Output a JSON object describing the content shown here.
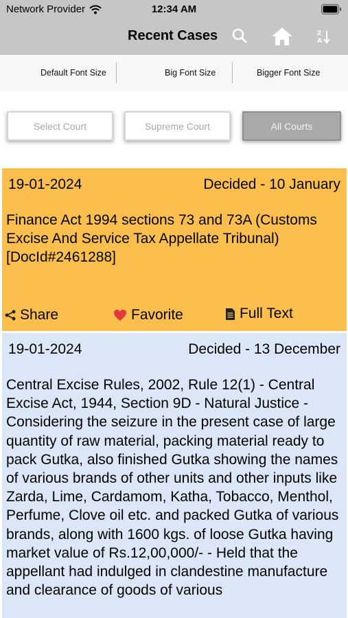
{
  "status_bar": {
    "carrier": "Network Provider",
    "time": "12:34 AM"
  },
  "nav": {
    "title": "Recent Cases",
    "icons": [
      "search-icon",
      "home-icon",
      "sort-icon"
    ]
  },
  "font_options": [
    "Default Font Size",
    "Big Font Size",
    "Bigger Font Size"
  ],
  "court_filters": [
    {
      "label": "Select Court",
      "active": false
    },
    {
      "label": "Supreme Court",
      "active": false
    },
    {
      "label": "All Courts",
      "active": true
    }
  ],
  "colors": {
    "nav_bg": "#c6c6c6",
    "card1_bg": "#fcbf4e",
    "card2_bg": "#dbe6f6",
    "heart": "#e0393e"
  },
  "cases": [
    {
      "date": "19-01-2024",
      "decided": "Decided - 10 January",
      "description": "Finance Act 1994 sections 73 and 73A (Customs Excise And Service Tax Appellate Tribunal) [DocId#2461288]",
      "actions": {
        "share": "Share",
        "favorite": "Favorite",
        "full_text": "Full Text"
      }
    },
    {
      "date": "19-01-2024",
      "decided": "Decided - 13 December",
      "description": "Central Excise Rules, 2002, Rule 12(1) - Central Excise Act, 1944, Section 9D - Natural Justice - Considering the seizure in the present case of large quantity of raw material, packing material ready to pack Gutka, also finished Gutka showing the names of various brands of other units and other inputs like Zarda, Lime, Cardamom, Katha, Tobacco, Menthol, Perfume, Clove oil etc. and packed Gutka of various brands, along with 1600 kgs. of loose Gutka having market value of Rs.12,00,000/- - Held that the appellant had indulged in clandestine manufacture and clearance of goods of various"
    }
  ]
}
